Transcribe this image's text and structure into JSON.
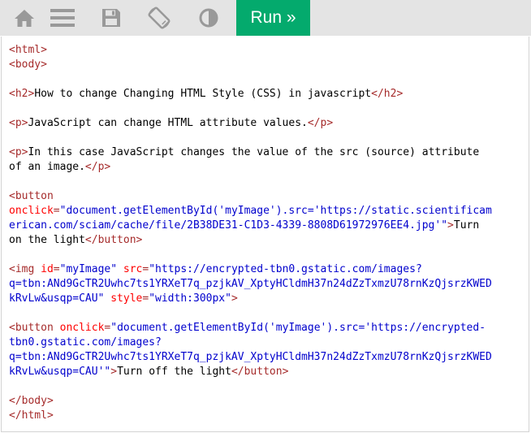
{
  "toolbar": {
    "icons": [
      "home-icon",
      "menu-icon",
      "save-icon",
      "rotate-icon",
      "contrast-icon"
    ],
    "run_label": "Run »"
  },
  "colors": {
    "toolbar_bg": "#e4e4e4",
    "icon": "#999999",
    "run_bg": "#04aa6d",
    "tag": "#a52a2a",
    "attribute": "#ff0000",
    "value": "#0000cd"
  },
  "code": {
    "lines": [
      [
        {
          "t": "tag",
          "s": "<html>"
        }
      ],
      [
        {
          "t": "tag",
          "s": "<body>"
        }
      ],
      [],
      [
        {
          "t": "tag",
          "s": "<h2>"
        },
        {
          "t": "txt",
          "s": "How to change Changing HTML Style (CSS) in javascript"
        },
        {
          "t": "tag",
          "s": "</h2>"
        }
      ],
      [],
      [
        {
          "t": "tag",
          "s": "<p>"
        },
        {
          "t": "txt",
          "s": "JavaScript can change HTML attribute values."
        },
        {
          "t": "tag",
          "s": "</p>"
        }
      ],
      [],
      [
        {
          "t": "tag",
          "s": "<p>"
        },
        {
          "t": "txt",
          "s": "In this case JavaScript changes the value of the src (source) attribute"
        }
      ],
      [
        {
          "t": "txt",
          "s": "of an image."
        },
        {
          "t": "tag",
          "s": "</p>"
        }
      ],
      [],
      [
        {
          "t": "tag",
          "s": "<button"
        }
      ],
      [
        {
          "t": "attr",
          "s": "onclick"
        },
        {
          "t": "tag",
          "s": "="
        },
        {
          "t": "val",
          "s": "\"document.getElementById('myImage').src='https://static.scientificam"
        }
      ],
      [
        {
          "t": "val",
          "s": "erican.com/sciam/cache/file/2B38DE31-C1D3-4339-8808D61972976EE4.jpg'\""
        },
        {
          "t": "tag",
          "s": ">"
        },
        {
          "t": "txt",
          "s": "Turn"
        }
      ],
      [
        {
          "t": "txt",
          "s": "on the light"
        },
        {
          "t": "tag",
          "s": "</button>"
        }
      ],
      [],
      [
        {
          "t": "tag",
          "s": "<img "
        },
        {
          "t": "attr",
          "s": "id"
        },
        {
          "t": "tag",
          "s": "="
        },
        {
          "t": "val",
          "s": "\"myImage\" "
        },
        {
          "t": "attr",
          "s": "src"
        },
        {
          "t": "tag",
          "s": "="
        },
        {
          "t": "val",
          "s": "\"https://encrypted-tbn0.gstatic.com/images?"
        }
      ],
      [
        {
          "t": "val",
          "s": "q=tbn:ANd9GcTR2Uwhc7ts1YRXeT7q_pzjkAV_XptyHCldmH37n24dZzTxmzU78rnKzQjsrzKWED"
        }
      ],
      [
        {
          "t": "val",
          "s": "kRvLw&usqp=CAU\" "
        },
        {
          "t": "attr",
          "s": "style"
        },
        {
          "t": "tag",
          "s": "="
        },
        {
          "t": "val",
          "s": "\"width:300px\""
        },
        {
          "t": "tag",
          "s": ">"
        }
      ],
      [],
      [
        {
          "t": "tag",
          "s": "<button "
        },
        {
          "t": "attr",
          "s": "onclick"
        },
        {
          "t": "tag",
          "s": "="
        },
        {
          "t": "val",
          "s": "\"document.getElementById('myImage').src='https://encrypted-"
        }
      ],
      [
        {
          "t": "val",
          "s": "tbn0.gstatic.com/images?"
        }
      ],
      [
        {
          "t": "val",
          "s": "q=tbn:ANd9GcTR2Uwhc7ts1YRXeT7q_pzjkAV_XptyHCldmH37n24dZzTxmzU78rnKzQjsrzKWED"
        }
      ],
      [
        {
          "t": "val",
          "s": "kRvLw&usqp=CAU'\""
        },
        {
          "t": "tag",
          "s": ">"
        },
        {
          "t": "txt",
          "s": "Turn off the light"
        },
        {
          "t": "tag",
          "s": "</button>"
        }
      ],
      [],
      [
        {
          "t": "tag",
          "s": "</body>"
        }
      ],
      [
        {
          "t": "tag",
          "s": "</html>"
        }
      ]
    ]
  }
}
